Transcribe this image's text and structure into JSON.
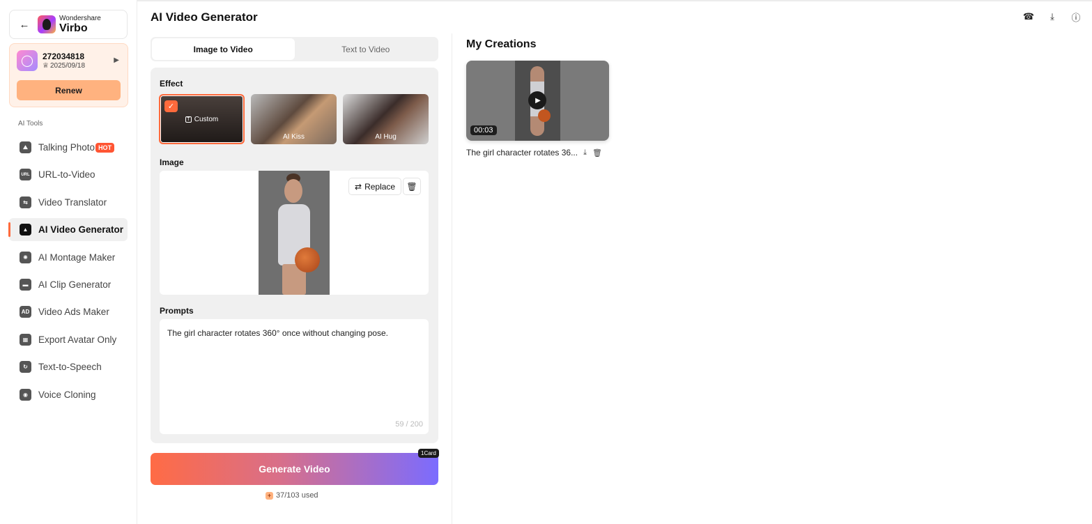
{
  "sidebar": {
    "brand_small": "Wondershare",
    "brand_name": "Virbo",
    "account_id": "272034818",
    "account_date": "2025/09/18",
    "renew_label": "Renew",
    "tools_heading": "AI Tools",
    "items": [
      {
        "label": "Talking Photo",
        "icon": "image-icon",
        "badge": "HOT"
      },
      {
        "label": "URL-to-Video",
        "icon": "url-icon",
        "icon_text": "URL"
      },
      {
        "label": "Video Translator",
        "icon": "translate-icon"
      },
      {
        "label": "AI Video Generator",
        "icon": "video-generator-icon",
        "active": true
      },
      {
        "label": "AI Montage Maker",
        "icon": "montage-icon"
      },
      {
        "label": "AI Clip Generator",
        "icon": "clip-icon"
      },
      {
        "label": "Video Ads Maker",
        "icon": "ads-icon",
        "icon_text": "AD"
      },
      {
        "label": "Export Avatar Only",
        "icon": "avatar-export-icon"
      },
      {
        "label": "Text-to-Speech",
        "icon": "speech-icon"
      },
      {
        "label": "Voice Cloning",
        "icon": "voice-clone-icon"
      }
    ]
  },
  "header": {
    "title": "AI Video Generator",
    "icons": [
      "headset-icon",
      "download-icon",
      "help-icon"
    ]
  },
  "tabs": [
    {
      "label": "Image to Video",
      "active": true
    },
    {
      "label": "Text to Video",
      "active": false
    }
  ],
  "form": {
    "effect_label": "Effect",
    "effects": [
      {
        "label": "Custom",
        "selected": true
      },
      {
        "label": "AI Kiss",
        "selected": false
      },
      {
        "label": "AI Hug",
        "selected": false
      }
    ],
    "image_label": "Image",
    "replace_label": "Replace",
    "prompts_label": "Prompts",
    "prompt_value": "The girl character rotates 360° once without changing pose.",
    "char_counter": "59 / 200"
  },
  "generate": {
    "label": "Generate Video",
    "badge": "1Card",
    "usage": "37/103 used"
  },
  "creations": {
    "title": "My Creations",
    "items": [
      {
        "duration": "00:03",
        "caption": "The girl character rotates 36..."
      }
    ]
  },
  "colors": {
    "accent": "#ff6a3c",
    "renew": "#ffb27f",
    "gradient_start": "#ff6b45",
    "gradient_end": "#7b6cff"
  }
}
